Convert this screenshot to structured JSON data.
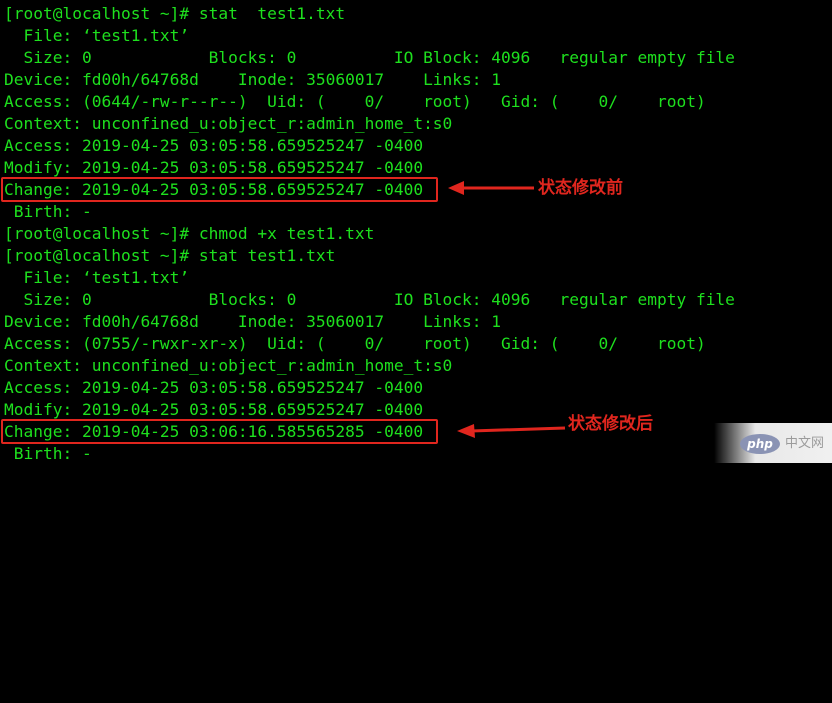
{
  "terminal": {
    "lines": [
      "[root@localhost ~]# stat  test1.txt",
      "  File: ‘test1.txt’",
      "  Size: 0            Blocks: 0          IO Block: 4096   regular empty file",
      "Device: fd00h/64768d    Inode: 35060017    Links: 1",
      "Access: (0644/-rw-r--r--)  Uid: (    0/    root)   Gid: (    0/    root)",
      "Context: unconfined_u:object_r:admin_home_t:s0",
      "Access: 2019-04-25 03:05:58.659525247 -0400",
      "Modify: 2019-04-25 03:05:58.659525247 -0400",
      "Change: 2019-04-25 03:05:58.659525247 -0400",
      " Birth: -",
      "[root@localhost ~]# chmod +x test1.txt",
      "[root@localhost ~]# stat test1.txt",
      "  File: ‘test1.txt’",
      "  Size: 0            Blocks: 0          IO Block: 4096   regular empty file",
      "Device: fd00h/64768d    Inode: 35060017    Links: 1",
      "Access: (0755/-rwxr-xr-x)  Uid: (    0/    root)   Gid: (    0/    root)",
      "Context: unconfined_u:object_r:admin_home_t:s0",
      "Access: 2019-04-25 03:05:58.659525247 -0400",
      "Modify: 2019-04-25 03:05:58.659525247 -0400",
      "Change: 2019-04-25 03:06:16.585565285 -0400",
      " Birth: -"
    ],
    "text_color": "#1ee01e",
    "background_color": "#000000"
  },
  "annotations": {
    "before_label": "状态修改前",
    "after_label": "状态修改后",
    "color": "#e0261e"
  },
  "watermark": {
    "logo_text": "php",
    "site_text": "中文网"
  }
}
